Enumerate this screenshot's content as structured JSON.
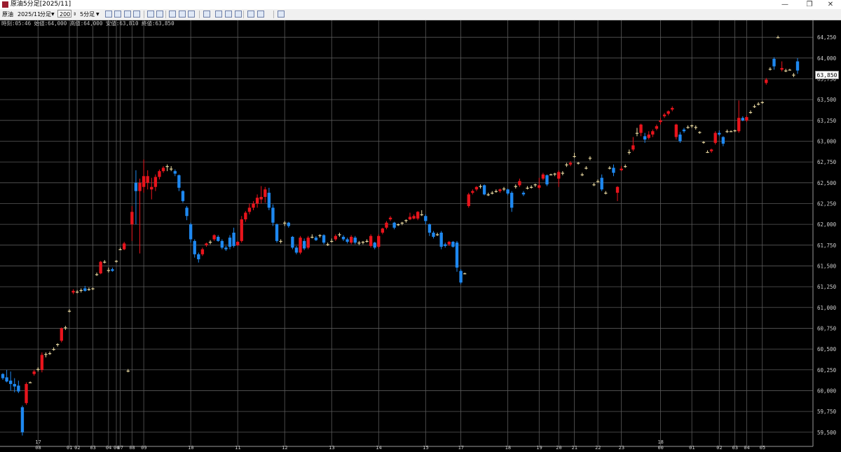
{
  "window": {
    "title": "原油5分足[2025/11]",
    "minimize_label": "—",
    "restore_label": "❐",
    "close_label": "✕"
  },
  "toolbar": {
    "commodity": "原油",
    "contract": "2025/11",
    "type": "分足",
    "count": "200",
    "interval": "5分足",
    "icons": [
      "cursor-icon",
      "hand-icon",
      "pencil-icon",
      "line-tool-icon",
      "select-icon",
      "refresh-icon",
      "window-icon",
      "grid-icon",
      "table-icon",
      "bar-chart-icon",
      "indicator-icon",
      "settings-icon",
      "pen-icon",
      "draw-icon",
      "clock-icon",
      "bell-icon"
    ]
  },
  "info_line": "時刻:05:46 始値:64,000 高値:64,000 安値:63,810 終値:63,850",
  "last_price": "63,850",
  "chart_data": {
    "type": "candlestick",
    "y_ticks": [
      59500,
      59750,
      60000,
      60250,
      60500,
      60750,
      61000,
      61250,
      61500,
      61750,
      62000,
      62250,
      62500,
      62750,
      63000,
      63250,
      63500,
      63750,
      64000,
      64250
    ],
    "y_tick_labels": [
      "59,500",
      "59,750",
      "60,000",
      "60,250",
      "60,500",
      "60,750",
      "61,000",
      "61,250",
      "61,500",
      "61,750",
      "62,000",
      "62,250",
      "62,500",
      "62,750",
      "63,000",
      "63,250",
      "63,500",
      "63,750",
      "64,000",
      "64,250"
    ],
    "ylim": [
      59380,
      64420
    ],
    "up_color": "#e8141c",
    "down_color": "#1e88f0",
    "doji_color": "#e8d8a0",
    "grid": true,
    "x_labels": [
      {
        "i": 9,
        "label": "08"
      },
      {
        "i": 17,
        "label": "01"
      },
      {
        "i": 19,
        "label": "02"
      },
      {
        "i": 23,
        "label": "03"
      },
      {
        "i": 27,
        "label": "04"
      },
      {
        "i": 29,
        "label": "06"
      },
      {
        "i": 30,
        "label": "07"
      },
      {
        "i": 33,
        "label": "08"
      },
      {
        "i": 36,
        "label": "09"
      },
      {
        "i": 48,
        "label": "10"
      },
      {
        "i": 60,
        "label": "11"
      },
      {
        "i": 72,
        "label": "12"
      },
      {
        "i": 84,
        "label": "13"
      },
      {
        "i": 96,
        "label": "14"
      },
      {
        "i": 108,
        "label": "15"
      },
      {
        "i": 117,
        "label": "17"
      },
      {
        "i": 129,
        "label": "18"
      },
      {
        "i": 137,
        "label": "19"
      },
      {
        "i": 142,
        "label": "20"
      },
      {
        "i": 146,
        "label": "21"
      },
      {
        "i": 152,
        "label": "22"
      },
      {
        "i": 158,
        "label": "23"
      },
      {
        "i": 168,
        "label": "00"
      },
      {
        "i": 176,
        "label": "01"
      },
      {
        "i": 183,
        "label": "02"
      },
      {
        "i": 187,
        "label": "03"
      },
      {
        "i": 190,
        "label": "04"
      },
      {
        "i": 194,
        "label": "05"
      }
    ],
    "date_markers": [
      {
        "i": 9,
        "label": "17"
      },
      {
        "i": 168,
        "label": "18"
      }
    ],
    "candles": [
      [
        60200,
        60210,
        60130,
        60150
      ],
      [
        60160,
        60250,
        60100,
        60110
      ],
      [
        60120,
        60230,
        60000,
        60080
      ],
      [
        60080,
        60150,
        59980,
        60050
      ],
      [
        60060,
        60120,
        59970,
        59990
      ],
      [
        59800,
        59820,
        59460,
        59500
      ],
      [
        59850,
        60100,
        59830,
        60080
      ],
      [
        60100,
        60110,
        60090,
        60100
      ],
      [
        60200,
        60250,
        60180,
        60230
      ],
      [
        60250,
        60280,
        60230,
        60260
      ],
      [
        60250,
        60460,
        60220,
        60430
      ],
      [
        60430,
        60460,
        60400,
        60440
      ],
      [
        60450,
        60470,
        60430,
        60450
      ],
      [
        60500,
        60520,
        60480,
        60500
      ],
      [
        60550,
        60570,
        60530,
        60560
      ],
      [
        60600,
        60760,
        60580,
        60750
      ],
      [
        60750,
        60780,
        60730,
        60760
      ],
      [
        60960,
        60980,
        60940,
        60960
      ],
      [
        61180,
        61220,
        61160,
        61200
      ],
      [
        61180,
        61210,
        61170,
        61190
      ],
      [
        61200,
        61230,
        61180,
        61210
      ],
      [
        61230,
        61260,
        61190,
        61200
      ],
      [
        61210,
        61240,
        61200,
        61220
      ],
      [
        61220,
        61240,
        61210,
        61230
      ],
      [
        61400,
        61420,
        61380,
        61400
      ],
      [
        61410,
        61560,
        61400,
        61550
      ],
      [
        61550,
        61570,
        61530,
        61540
      ],
      [
        61450,
        61480,
        61420,
        61440
      ],
      [
        61460,
        61480,
        61430,
        61440
      ],
      [
        61560,
        61570,
        61540,
        61560
      ],
      [
        61700,
        61720,
        61690,
        61700
      ],
      [
        61700,
        61790,
        61690,
        61770
      ],
      [
        60240,
        60260,
        60220,
        60240
      ],
      [
        62000,
        62220,
        61800,
        62150
      ],
      [
        62500,
        62650,
        62000,
        62400
      ],
      [
        62400,
        62550,
        61650,
        62500
      ],
      [
        62450,
        62780,
        62380,
        62580
      ],
      [
        62500,
        62650,
        62420,
        62580
      ],
      [
        62420,
        62560,
        62300,
        62450
      ],
      [
        62450,
        62600,
        62400,
        62570
      ],
      [
        62570,
        62660,
        62540,
        62640
      ],
      [
        62640,
        62700,
        62620,
        62680
      ],
      [
        62700,
        62720,
        62640,
        62690
      ],
      [
        62670,
        62700,
        62640,
        62660
      ],
      [
        62640,
        62660,
        62580,
        62610
      ],
      [
        62590,
        62600,
        62400,
        62440
      ],
      [
        62400,
        62410,
        62260,
        62280
      ],
      [
        62200,
        62220,
        62050,
        62100
      ],
      [
        62000,
        62020,
        61780,
        61820
      ],
      [
        61800,
        61820,
        61600,
        61640
      ],
      [
        61640,
        61660,
        61540,
        61580
      ],
      [
        61640,
        61720,
        61620,
        61700
      ],
      [
        61750,
        61780,
        61730,
        61770
      ],
      [
        61780,
        61810,
        61760,
        61790
      ],
      [
        61820,
        61880,
        61800,
        61870
      ],
      [
        61850,
        61870,
        61790,
        61800
      ],
      [
        61800,
        61820,
        61700,
        61720
      ],
      [
        61720,
        61740,
        61680,
        61700
      ],
      [
        61840,
        61870,
        61700,
        61730
      ],
      [
        61900,
        61960,
        61720,
        61740
      ],
      [
        61750,
        61800,
        61740,
        61790
      ],
      [
        61800,
        62100,
        61780,
        62060
      ],
      [
        62060,
        62160,
        62030,
        62140
      ],
      [
        62150,
        62250,
        62120,
        62200
      ],
      [
        62200,
        62280,
        62170,
        62250
      ],
      [
        62250,
        62360,
        62200,
        62320
      ],
      [
        62300,
        62460,
        62250,
        62330
      ],
      [
        62330,
        62450,
        62260,
        62420
      ],
      [
        62380,
        62440,
        62170,
        62200
      ],
      [
        62200,
        62240,
        61980,
        62020
      ],
      [
        62000,
        62010,
        61780,
        61800
      ],
      [
        61800,
        61820,
        61770,
        61790
      ],
      [
        62010,
        62040,
        61980,
        62020
      ],
      [
        62020,
        62030,
        61960,
        61980
      ],
      [
        61850,
        61860,
        61700,
        61720
      ],
      [
        61720,
        61740,
        61640,
        61660
      ],
      [
        61660,
        61860,
        61640,
        61840
      ],
      [
        61800,
        61830,
        61690,
        61710
      ],
      [
        61720,
        61860,
        61700,
        61840
      ],
      [
        61850,
        61880,
        61830,
        61850
      ],
      [
        61840,
        61860,
        61800,
        61810
      ],
      [
        61860,
        61880,
        61840,
        61870
      ],
      [
        61870,
        61880,
        61760,
        61780
      ],
      [
        61760,
        61780,
        61740,
        61760
      ],
      [
        61800,
        61830,
        61780,
        61800
      ],
      [
        61820,
        61880,
        61800,
        61860
      ],
      [
        61880,
        61900,
        61850,
        61870
      ],
      [
        61850,
        61870,
        61800,
        61820
      ],
      [
        61820,
        61840,
        61770,
        61790
      ],
      [
        61780,
        61870,
        61760,
        61850
      ],
      [
        61840,
        61860,
        61760,
        61780
      ],
      [
        61780,
        61800,
        61750,
        61770
      ],
      [
        61780,
        61800,
        61760,
        61790
      ],
      [
        61800,
        61820,
        61780,
        61800
      ],
      [
        61740,
        61880,
        61720,
        61860
      ],
      [
        61780,
        61790,
        61700,
        61720
      ],
      [
        61730,
        61880,
        61710,
        61860
      ],
      [
        61900,
        61960,
        61880,
        61950
      ],
      [
        61960,
        62040,
        61940,
        62020
      ],
      [
        62060,
        62100,
        62040,
        62080
      ],
      [
        62020,
        62030,
        61940,
        61960
      ],
      [
        61990,
        62010,
        61980,
        62000
      ],
      [
        62010,
        62030,
        61990,
        62020
      ],
      [
        62040,
        62060,
        62020,
        62050
      ],
      [
        62060,
        62140,
        62050,
        62090
      ],
      [
        62070,
        62120,
        62060,
        62100
      ],
      [
        62070,
        62160,
        62050,
        62150
      ],
      [
        62120,
        62170,
        62100,
        62110
      ],
      [
        62100,
        62120,
        62000,
        62040
      ],
      [
        62000,
        62010,
        61860,
        61900
      ],
      [
        61900,
        61920,
        61830,
        61850
      ],
      [
        61880,
        61900,
        61860,
        61870
      ],
      [
        61900,
        61920,
        61700,
        61730
      ],
      [
        61760,
        61780,
        61720,
        61740
      ],
      [
        61760,
        61800,
        61740,
        61790
      ],
      [
        61790,
        61800,
        61720,
        61730
      ],
      [
        61780,
        61800,
        61430,
        61480
      ],
      [
        61440,
        61460,
        61280,
        61300
      ],
      [
        61410,
        61420,
        61400,
        61410
      ],
      [
        62220,
        62380,
        62200,
        62360
      ],
      [
        62380,
        62420,
        62360,
        62400
      ],
      [
        62420,
        62460,
        62400,
        62450
      ],
      [
        62450,
        62480,
        62430,
        62460
      ],
      [
        62470,
        62480,
        62350,
        62360
      ],
      [
        62360,
        62380,
        62340,
        62350
      ],
      [
        62380,
        62400,
        62360,
        62380
      ],
      [
        62400,
        62420,
        62380,
        62390
      ],
      [
        62400,
        62430,
        62380,
        62420
      ],
      [
        62430,
        62450,
        62400,
        62430
      ],
      [
        62420,
        62430,
        62350,
        62370
      ],
      [
        62380,
        62400,
        62150,
        62200
      ],
      [
        62450,
        62480,
        62430,
        62460
      ],
      [
        62470,
        62550,
        62450,
        62520
      ],
      [
        62380,
        62400,
        62340,
        62360
      ],
      [
        62440,
        62460,
        62420,
        62440
      ],
      [
        62450,
        62470,
        62430,
        62450
      ],
      [
        62470,
        62490,
        62450,
        62480
      ],
      [
        62440,
        62560,
        62420,
        62470
      ],
      [
        62550,
        62620,
        62530,
        62600
      ],
      [
        62590,
        62600,
        62460,
        62480
      ],
      [
        62600,
        62610,
        62590,
        62600
      ],
      [
        62600,
        62620,
        62580,
        62610
      ],
      [
        62550,
        62650,
        62450,
        62630
      ],
      [
        62610,
        62640,
        62590,
        62620
      ],
      [
        62710,
        62740,
        62690,
        62720
      ],
      [
        62720,
        62760,
        62700,
        62740
      ],
      [
        62820,
        62860,
        62800,
        62810
      ],
      [
        62740,
        62750,
        62720,
        62730
      ],
      [
        62600,
        62620,
        62580,
        62600
      ],
      [
        62680,
        62700,
        62660,
        62680
      ],
      [
        62790,
        62820,
        62770,
        62800
      ],
      [
        62480,
        62500,
        62460,
        62480
      ],
      [
        62520,
        62540,
        62500,
        62520
      ],
      [
        62560,
        62600,
        62400,
        62420
      ],
      [
        62380,
        62400,
        62360,
        62380
      ],
      [
        62680,
        62700,
        62660,
        62680
      ],
      [
        62680,
        62720,
        62580,
        62620
      ],
      [
        62380,
        62460,
        62280,
        62450
      ],
      [
        62650,
        62700,
        62640,
        62670
      ],
      [
        62700,
        62720,
        62680,
        62700
      ],
      [
        62860,
        62900,
        62840,
        62870
      ],
      [
        62900,
        63050,
        62880,
        62950
      ],
      [
        63100,
        63160,
        63060,
        63100
      ],
      [
        63100,
        63210,
        63060,
        63200
      ],
      [
        63060,
        63100,
        62980,
        63020
      ],
      [
        63040,
        63120,
        63020,
        63080
      ],
      [
        63080,
        63140,
        63050,
        63120
      ],
      [
        63150,
        63200,
        63130,
        63180
      ],
      [
        63230,
        63280,
        63200,
        63250
      ],
      [
        63300,
        63340,
        63280,
        63320
      ],
      [
        63330,
        63370,
        63310,
        63360
      ],
      [
        63380,
        63420,
        63360,
        63400
      ],
      [
        63050,
        63210,
        63020,
        63200
      ],
      [
        63080,
        63110,
        62980,
        63000
      ],
      [
        63140,
        63160,
        63100,
        63120
      ],
      [
        63170,
        63190,
        63150,
        63170
      ],
      [
        63180,
        63200,
        63160,
        63190
      ],
      [
        63160,
        63190,
        63140,
        63170
      ],
      [
        63100,
        63120,
        63090,
        63110
      ],
      [
        62980,
        63000,
        62970,
        62990
      ],
      [
        62870,
        62890,
        62860,
        62870
      ],
      [
        62880,
        62910,
        62860,
        62900
      ],
      [
        62980,
        63120,
        62960,
        63100
      ],
      [
        63100,
        63130,
        63060,
        63080
      ],
      [
        63050,
        63060,
        62940,
        62970
      ],
      [
        63120,
        63140,
        63100,
        63120
      ],
      [
        63120,
        63130,
        63110,
        63120
      ],
      [
        63130,
        63140,
        63110,
        63130
      ],
      [
        63120,
        63490,
        63100,
        63280
      ],
      [
        63280,
        63300,
        63240,
        63250
      ],
      [
        63250,
        63310,
        63230,
        63290
      ],
      [
        63350,
        63370,
        63330,
        63350
      ],
      [
        63420,
        63440,
        63400,
        63420
      ],
      [
        63450,
        63470,
        63430,
        63450
      ],
      [
        63460,
        63480,
        63450,
        63470
      ],
      [
        63700,
        63760,
        63680,
        63740
      ],
      [
        63870,
        63890,
        63850,
        63870
      ],
      [
        63990,
        64010,
        63860,
        63900
      ],
      [
        64250,
        64270,
        64240,
        64250
      ],
      [
        63860,
        63960,
        63840,
        63880
      ],
      [
        63850,
        63870,
        63830,
        63850
      ],
      [
        63860,
        63870,
        63850,
        63860
      ],
      [
        63800,
        63820,
        63770,
        63790
      ],
      [
        63960,
        64000,
        63810,
        63850
      ]
    ]
  }
}
